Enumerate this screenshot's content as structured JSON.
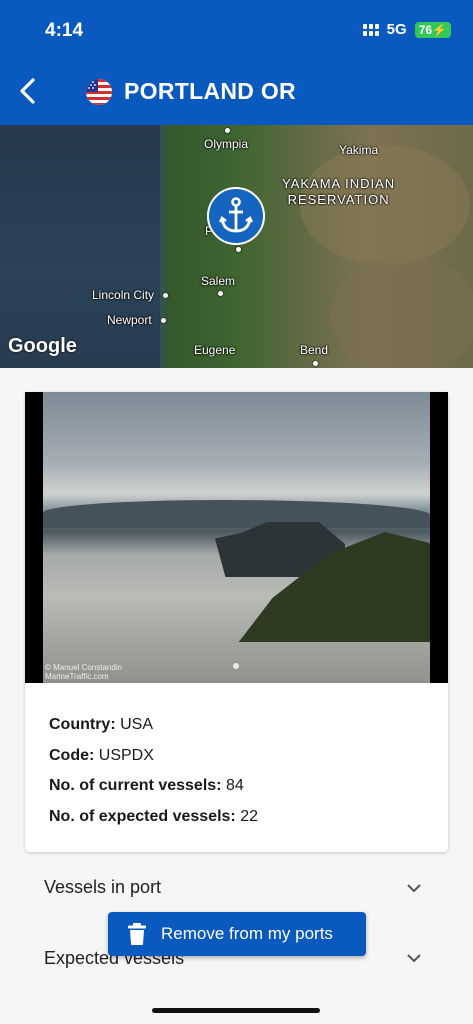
{
  "status_bar": {
    "time": "4:14",
    "network": "5G",
    "battery": "76"
  },
  "header": {
    "title": "PORTLAND OR",
    "back_icon": "chevron-left-icon",
    "flag_icon": "us-flag-icon"
  },
  "map": {
    "labels": [
      "Olympia",
      "Yakima",
      "YAKAMA INDIAN",
      "RESERVATION",
      "Portland",
      "Salem",
      "Lincoln City",
      "Newport",
      "Eugene",
      "Bend"
    ],
    "attribution": "Google",
    "marker_icon": "anchor-icon"
  },
  "photo": {
    "credit_line1": "© Manuel Constandin",
    "credit_line2": "MarineTraffic.com"
  },
  "details": [
    {
      "key": "Country:",
      "value": "USA"
    },
    {
      "key": "Code:",
      "value": "USPDX"
    },
    {
      "key": "No. of current vessels:",
      "value": "84"
    },
    {
      "key": "No. of expected vessels:",
      "value": "22"
    }
  ],
  "sections": {
    "vessels_in_port": "Vessels in port",
    "expected_vessels": "Expected vessels"
  },
  "remove_button": {
    "label": "Remove from my ports",
    "icon": "trash-icon"
  },
  "colors": {
    "primary": "#0a59bf",
    "background": "#f6f6f7"
  }
}
